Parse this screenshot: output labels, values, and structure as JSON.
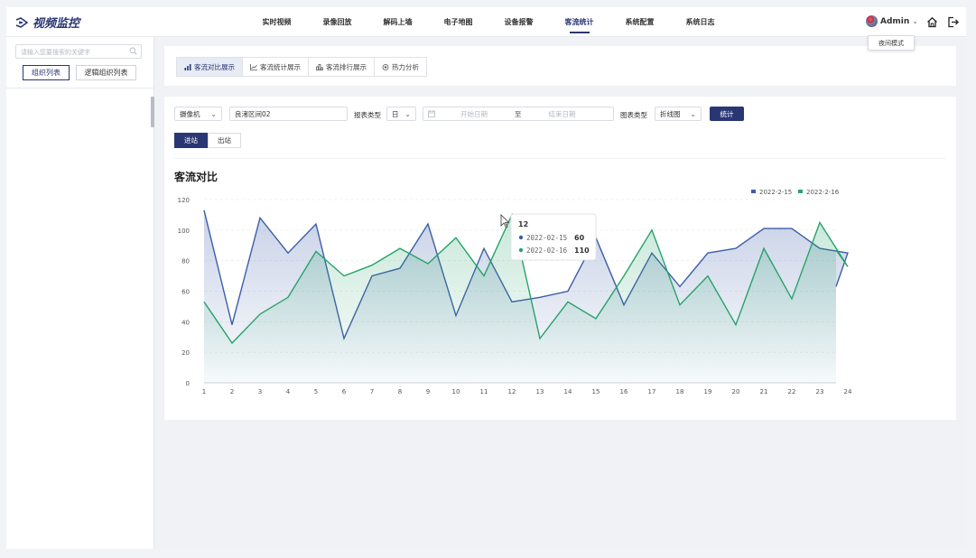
{
  "app": {
    "title": "视频监控"
  },
  "nav": {
    "items": [
      "实时视频",
      "录像回放",
      "解码上墙",
      "电子地图",
      "设备报警",
      "客流统计",
      "系统配置",
      "系统日志"
    ],
    "active_index": 5
  },
  "user": {
    "name": "Admin"
  },
  "tooltip_top": {
    "text": "夜间模式"
  },
  "sidebar": {
    "search_placeholder": "请输入您要搜索的关键字",
    "tabs": [
      "组织列表",
      "逻辑组织列表"
    ],
    "active_tab": 0
  },
  "tabs": [
    {
      "label": "客流对比展示",
      "icon": "bar-chart-icon"
    },
    {
      "label": "客流统计展示",
      "icon": "line-chart-icon"
    },
    {
      "label": "客流排行展示",
      "icon": "ranking-icon"
    },
    {
      "label": "热力分析",
      "icon": "heat-icon"
    }
  ],
  "filters": {
    "device_type": "摄像机",
    "location": "良渚区间02",
    "report_type_label": "报表类型",
    "report_type": "日",
    "start_placeholder": "开始日期",
    "range_sep": "至",
    "end_placeholder": "结束日期",
    "chart_type_label": "图表类型",
    "chart_type": "折线图",
    "submit": "统计"
  },
  "direction": {
    "options": [
      "进站",
      "出站"
    ],
    "active": 0
  },
  "colors": {
    "accent": "#2a3674",
    "series1": "#3b5ea8",
    "series2": "#27a36a"
  },
  "chart_data": {
    "type": "area",
    "title": "客流对比",
    "x": [
      1,
      2,
      3,
      4,
      5,
      6,
      7,
      8,
      9,
      10,
      11,
      12,
      13,
      14,
      15,
      16,
      17,
      18,
      19,
      20,
      21,
      22,
      23,
      24
    ],
    "ylim": [
      0,
      120
    ],
    "yticks": [
      0,
      20,
      40,
      60,
      80,
      100,
      120
    ],
    "legend_position": "top-right",
    "series": [
      {
        "name": "2022-2-15",
        "values": [
          113,
          38,
          108,
          85,
          104,
          29,
          70,
          75,
          104,
          44,
          88,
          53,
          56,
          60,
          95,
          51,
          85,
          63,
          85,
          88,
          101,
          101,
          88,
          85
        ]
      },
      {
        "name": "2022-2-16",
        "values": [
          53,
          26,
          45,
          56,
          86,
          70,
          77,
          88,
          78,
          95,
          70,
          110,
          29,
          53,
          42,
          70,
          100,
          51,
          70,
          38,
          88,
          55,
          105,
          76
        ]
      }
    ],
    "series_extra_tail": [
      63,
      87
    ],
    "tooltip": {
      "x": "12",
      "rows": [
        {
          "label": "2022-02-15",
          "value": "60"
        },
        {
          "label": "2022-02-16",
          "value": "110"
        }
      ]
    }
  }
}
